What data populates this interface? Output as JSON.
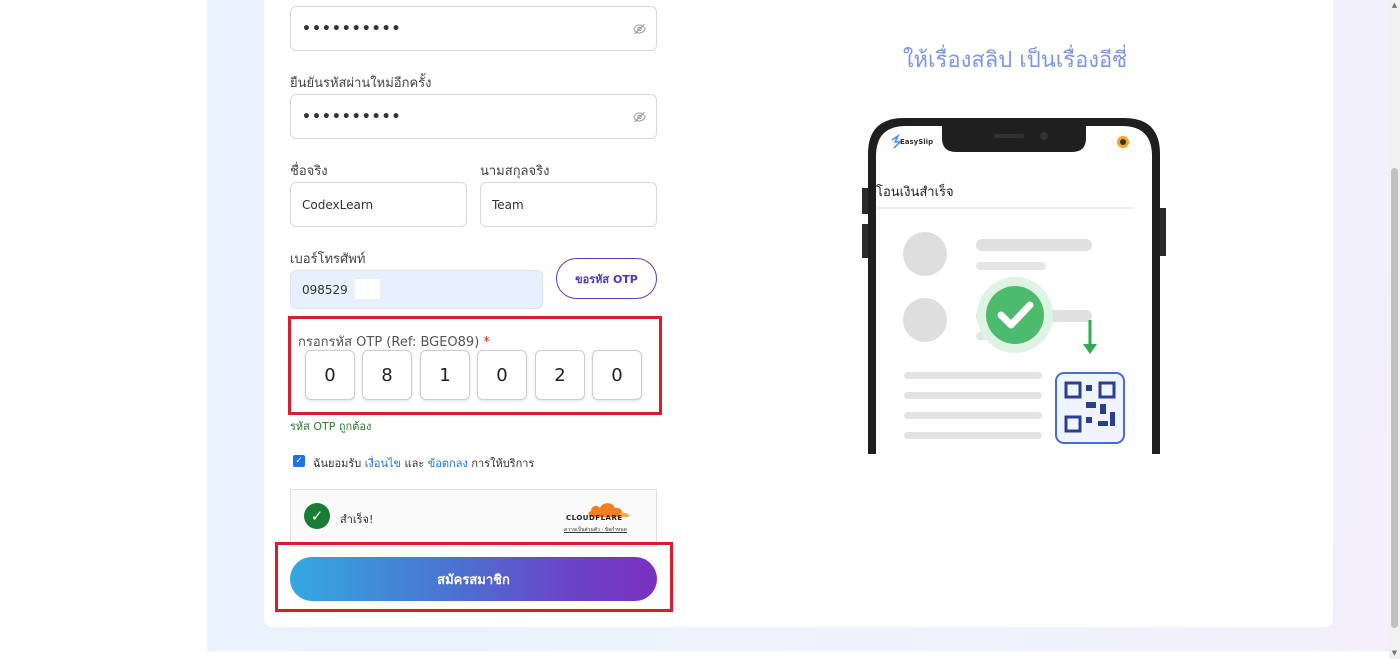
{
  "form": {
    "password_value": "••••••••••",
    "confirm_label": "ยืนยันรหัสผ่านใหม่อีกครั้ง",
    "confirm_value": "••••••••••",
    "first_name_label": "ชื่อจริง",
    "first_name_value": "CodexLearn",
    "last_name_label": "นามสกุลจริง",
    "last_name_value": "Team",
    "phone_label": "เบอร์โทรศัพท์",
    "phone_value": "098529",
    "otp_button": "ขอรหัส OTP",
    "otp_label": "กรอกรหัส OTP (Ref: BGEO89)",
    "otp_required": "*",
    "otp_digits": [
      "0",
      "8",
      "1",
      "0",
      "2",
      "0"
    ],
    "otp_status": "รหัส OTP ถูกต้อง",
    "agree_prefix": "ฉันยอมรับ",
    "agree_link1": "เงื่อนไข",
    "agree_mid": "และ",
    "agree_link2": "ข้อตกลง",
    "agree_suffix": "การให้บริการ",
    "agree_checked": true,
    "submit_label": "สมัครสมาชิก"
  },
  "captcha": {
    "status_text": "สำเร็จ!",
    "provider": "CLOUDFLARE",
    "privacy_link": "ความเป็นส่วนตัว",
    "separator": "·",
    "terms_link": "ข้อกำหนด"
  },
  "promo": {
    "tagline": "ให้เรื่องสลิป เป็นเรื่องอีซี่",
    "app_name": "EasySlip",
    "screen_title": "โอนเงินสำเร็จ"
  },
  "colors": {
    "accent": "#5a3fd1",
    "highlight_box": "#d32029",
    "success": "#197e33",
    "tagline": "#7e96e6",
    "cloudflare": "#f38020"
  }
}
